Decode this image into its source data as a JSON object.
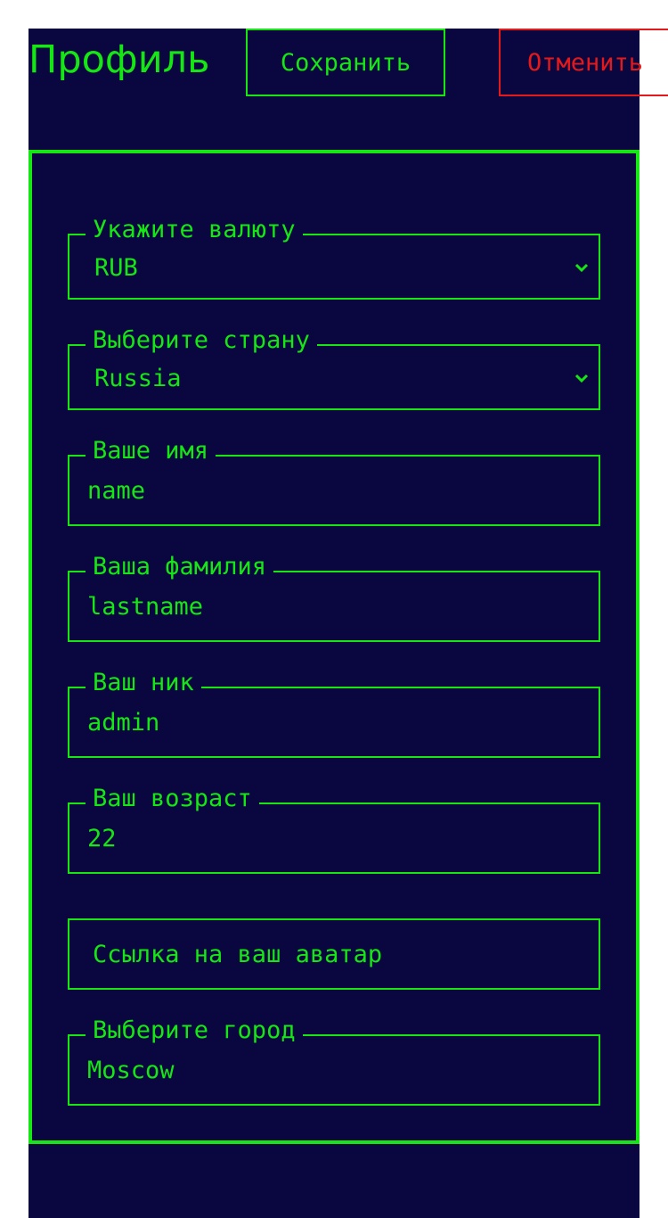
{
  "header": {
    "title": "Профиль",
    "save_label": "Сохранить",
    "cancel_label": "Отменить"
  },
  "form": {
    "currency": {
      "label": "Укажите валюту",
      "value": "RUB"
    },
    "country": {
      "label": "Выберите страну",
      "value": "Russia"
    },
    "first_name": {
      "label": "Ваше имя",
      "value": "name"
    },
    "last_name": {
      "label": "Ваша фамилия",
      "value": "lastname"
    },
    "nickname": {
      "label": "Ваш ник",
      "value": "admin"
    },
    "age": {
      "label": "Ваш возраст",
      "value": "22"
    },
    "avatar": {
      "placeholder": "Ссылка на ваш аватар"
    },
    "city": {
      "label": "Выберите город",
      "value": "Moscow"
    }
  },
  "icons": {
    "select_arrow": "chevron-down-icon"
  },
  "colors": {
    "background": "#090640",
    "accent": "#15e614",
    "danger": "#e41a1a",
    "page": "#ffffff"
  }
}
